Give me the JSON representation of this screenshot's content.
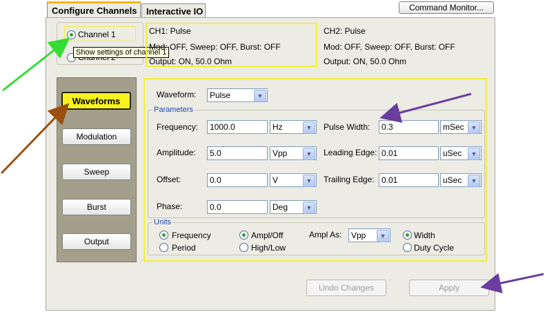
{
  "tabs": [
    {
      "label": "Configure Channels",
      "active": true
    },
    {
      "label": "Interactive IO",
      "active": false
    }
  ],
  "command_monitor_label": "Command Monitor...",
  "channel_select": {
    "channel1_label": "Channel 1",
    "channel2_label": "Channel 2",
    "tooltip": "Show settings of channel 1"
  },
  "ch1_summary": {
    "title": "CH1:  Pulse",
    "mod": "Mod: OFF, Sweep: OFF, Burst: OFF",
    "output": "Output:  ON, 50.0 Ohm"
  },
  "ch2_summary": {
    "title": "CH2:  Pulse",
    "mod": "Mod: OFF, Sweep: OFF, Burst: OFF",
    "output": "Output:  ON, 50.0 Ohm"
  },
  "side_nav": {
    "waveforms": "Waveforms",
    "modulation": "Modulation",
    "sweep": "Sweep",
    "burst": "Burst",
    "output": "Output"
  },
  "waveform": {
    "label": "Waveform:",
    "value": "Pulse"
  },
  "parameters": {
    "title": "Parameters",
    "frequency": {
      "label": "Frequency:",
      "value": "1000.0",
      "unit": "Hz"
    },
    "amplitude": {
      "label": "Amplitude:",
      "value": "5.0",
      "unit": "Vpp"
    },
    "offset": {
      "label": "Offset:",
      "value": "0.0",
      "unit": "V"
    },
    "phase": {
      "label": "Phase:",
      "value": "0.0",
      "unit": "Deg"
    },
    "pulse_width": {
      "label": "Pulse Width:",
      "value": "0.3",
      "unit": "mSec"
    },
    "leading_edge": {
      "label": "Leading Edge:",
      "value": "0.01",
      "unit": "uSec"
    },
    "trailing_edge": {
      "label": "Trailing Edge:",
      "value": "0.01",
      "unit": "uSec"
    }
  },
  "units": {
    "title": "Units",
    "frequency": "Frequency",
    "period": "Period",
    "ampl_off": "Ampl/Off",
    "high_low": "High/Low",
    "ampl_as_label": "Ampl As:",
    "ampl_as_value": "Vpp",
    "width": "Width",
    "duty_cycle": "Duty Cycle"
  },
  "buttons": {
    "undo": "Undo Changes",
    "apply": "Apply"
  },
  "colors": {
    "highlight_yellow": "#f2ee3a",
    "arrow_green": "#33dd33",
    "arrow_brown": "#9a4e10",
    "arrow_purple": "#6b3d9e",
    "panel_bg": "#ecebe4",
    "nav_bg": "#a49f8b"
  }
}
